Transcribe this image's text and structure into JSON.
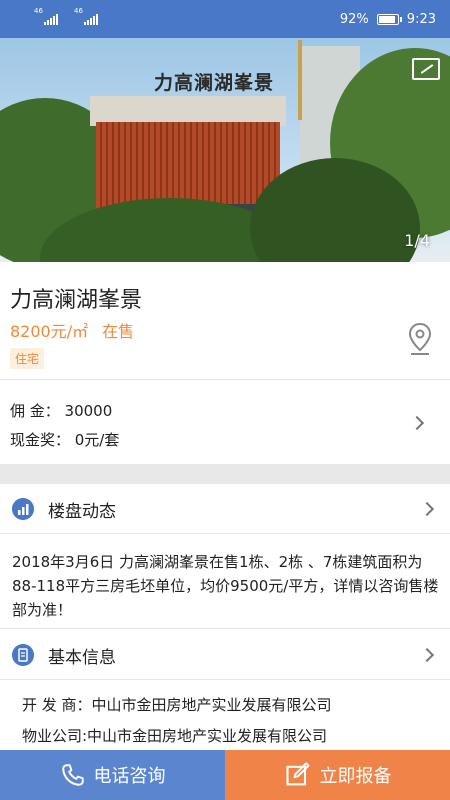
{
  "status_bar": {
    "signal1": "46",
    "signal2": "46",
    "battery": "92%",
    "time": "9:23"
  },
  "gallery": {
    "counter": "1/4",
    "sign_text": "力高澜湖峯景"
  },
  "property": {
    "title": "力高澜湖峯景",
    "price": "8200元/㎡",
    "status": "在售",
    "tag": "住宅",
    "commission": "佣  金：  30000",
    "cash_bonus": "现金奖：  0元/套"
  },
  "sections": {
    "news_title": "楼盘动态",
    "news_text": "2018年3月6日 力高澜湖峯景在售1栋、2栋 、7栋建筑面积为88-118平方三房毛坯单位，均价9500元/平方，详情以咨询售楼部为准！",
    "basic_title": "基本信息",
    "developer": "开 发 商：中山市金田房地产实业发展有限公司",
    "property_company": "物业公司:中山市金田房地产实业发展有限公司"
  },
  "bottom": {
    "call_label": "电话咨询",
    "report_label": "立即报备"
  },
  "colors": {
    "primary": "#4a78c8",
    "accent": "#f08a3a"
  }
}
